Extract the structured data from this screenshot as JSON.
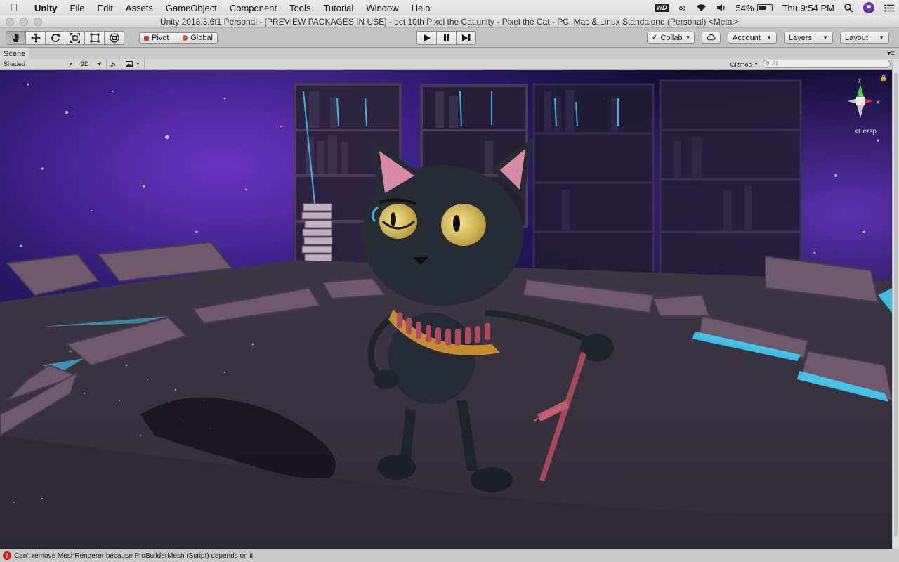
{
  "menubar": {
    "items": [
      "Unity",
      "File",
      "Edit",
      "Assets",
      "GameObject",
      "Component",
      "Tools",
      "Tutorial",
      "Window",
      "Help"
    ],
    "wd_badge": "WD",
    "battery": "54%",
    "battery_level": 0.54,
    "clock": "Thu 9:54 PM"
  },
  "window": {
    "title": "Unity 2018.3.6f1 Personal - [PREVIEW PACKAGES IN USE] - oct 10th Pixel the Cat.unity - Pixel the Cat - PC, Mac & Linux Standalone (Personal) <Metal>"
  },
  "toolbar": {
    "pivot_label": "Pivot",
    "global_label": "Global",
    "collab_label": "Collab",
    "account_label": "Account",
    "layers_label": "Layers",
    "layout_label": "Layout"
  },
  "scene": {
    "tab_label": "Scene",
    "shading_mode": "Shaded",
    "mode_2d": "2D",
    "gizmos_label": "Gizmos",
    "search_placeholder": "All",
    "persp_label": "Persp",
    "axis_x": "x",
    "axis_y": "y"
  },
  "status": {
    "message": "Can't remove MeshRenderer because ProBuilderMesh (Script) depends on it"
  },
  "colors": {
    "accent_cyan": "#3fd6ff",
    "error_red": "#d11111",
    "floor": "#3b3540"
  }
}
